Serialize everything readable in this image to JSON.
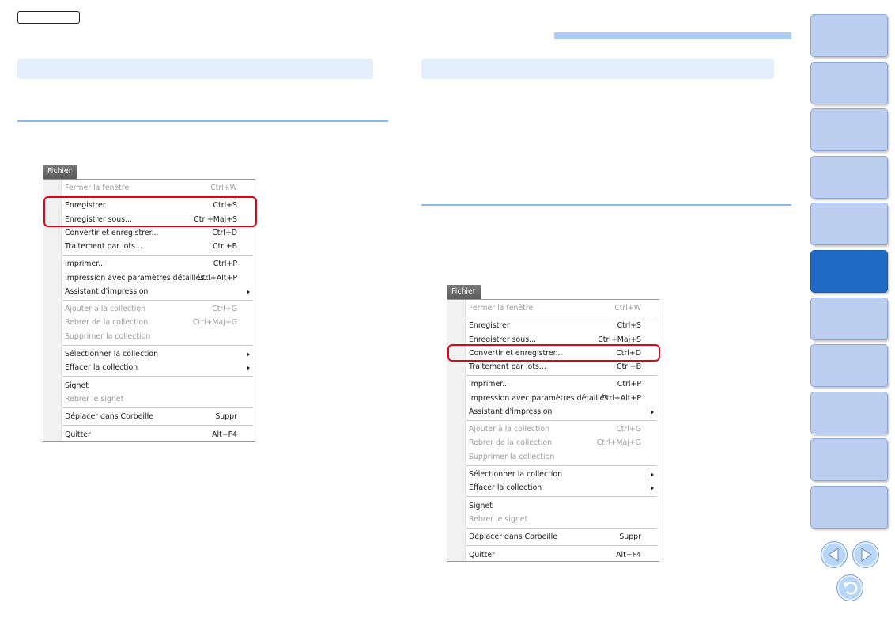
{
  "menu_title": "Fichier",
  "menus": [
    {
      "items": [
        {
          "label": "Fermer la fenêtre",
          "shortcut": "Ctrl+W",
          "disabled": true
        },
        {
          "sep": true
        },
        {
          "label": "Enregistrer",
          "shortcut": "Ctrl+S"
        },
        {
          "label": "Enregistrer sous...",
          "shortcut": "Ctrl+Maj+S"
        },
        {
          "label": "Convertir et enregistrer...",
          "shortcut": "Ctrl+D"
        },
        {
          "label": "Traitement par lots...",
          "shortcut": "Ctrl+B"
        },
        {
          "sep": true
        },
        {
          "label": "Imprimer...",
          "shortcut": "Ctrl+P"
        },
        {
          "label": "Impression avec paramètres détaillés...",
          "shortcut": "Ctrl+Alt+P"
        },
        {
          "label": "Assistant d'impression",
          "submenu": true
        },
        {
          "sep": true
        },
        {
          "label": "Ajouter à la collection",
          "shortcut": "Ctrl+G",
          "disabled": true
        },
        {
          "label": "Rebrer de la collection",
          "shortcut": "Ctrl+Maj+G",
          "disabled": true
        },
        {
          "label": "Supprimer la collection",
          "disabled": true
        },
        {
          "sep": true
        },
        {
          "label": "Sélectionner la collection",
          "submenu": true
        },
        {
          "label": "Effacer la collection",
          "submenu": true
        },
        {
          "sep": true
        },
        {
          "label": "Signet"
        },
        {
          "label": "Rebrer le signet",
          "disabled": true
        },
        {
          "sep": true
        },
        {
          "label": "Déplacer dans Corbeille",
          "shortcut": "Suppr"
        },
        {
          "sep": true
        },
        {
          "label": "Quitter",
          "shortcut": "Alt+F4"
        }
      ]
    },
    {
      "items": [
        {
          "label": "Fermer la fenêtre",
          "shortcut": "Ctrl+W",
          "disabled": true
        },
        {
          "sep": true
        },
        {
          "label": "Enregistrer",
          "shortcut": "Ctrl+S"
        },
        {
          "label": "Enregistrer sous...",
          "shortcut": "Ctrl+Maj+S"
        },
        {
          "label": "Convertir et enregistrer...",
          "shortcut": "Ctrl+D"
        },
        {
          "label": "Traitement par lots...",
          "shortcut": "Ctrl+B"
        },
        {
          "sep": true
        },
        {
          "label": "Imprimer...",
          "shortcut": "Ctrl+P"
        },
        {
          "label": "Impression avec paramètres détaillés...",
          "shortcut": "Ctrl+Alt+P"
        },
        {
          "label": "Assistant d'impression",
          "submenu": true
        },
        {
          "sep": true
        },
        {
          "label": "Ajouter à la collection",
          "shortcut": "Ctrl+G",
          "disabled": true
        },
        {
          "label": "Rebrer de la collection",
          "shortcut": "Ctrl+Maj+G",
          "disabled": true
        },
        {
          "label": "Supprimer la collection",
          "disabled": true
        },
        {
          "sep": true
        },
        {
          "label": "Sélectionner la collection",
          "submenu": true
        },
        {
          "label": "Effacer la collection",
          "submenu": true
        },
        {
          "sep": true
        },
        {
          "label": "Signet"
        },
        {
          "label": "Rebrer le signet",
          "disabled": true
        },
        {
          "sep": true
        },
        {
          "label": "Déplacer dans Corbeille",
          "shortcut": "Suppr"
        },
        {
          "sep": true
        },
        {
          "label": "Quitter",
          "shortcut": "Alt+F4"
        }
      ]
    }
  ],
  "side_tabs": {
    "count": 11,
    "active_index": 5
  },
  "nav": {
    "prev_icon": "arrow-left-icon",
    "next_icon": "arrow-right-icon",
    "back_icon": "return-icon"
  },
  "colors": {
    "highlight": "#e60012",
    "accent": "#1f6bc4",
    "tab": "#bccff0",
    "header": "#e4effb"
  }
}
